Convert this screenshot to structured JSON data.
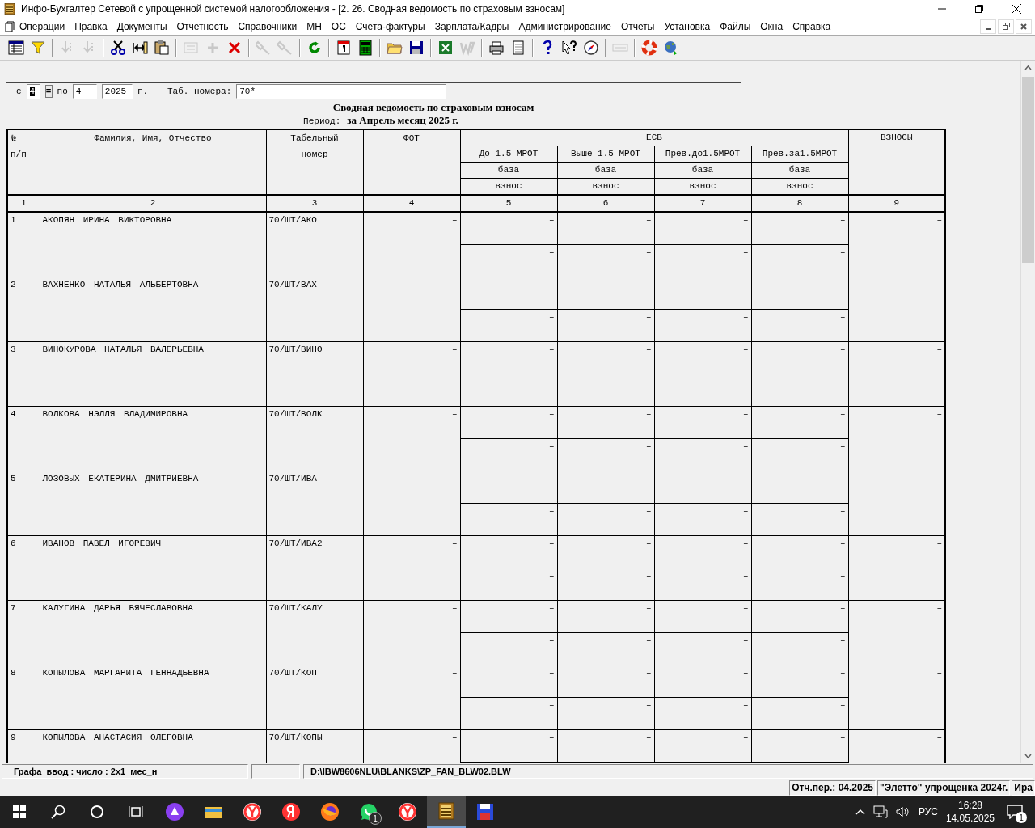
{
  "window": {
    "title": "Инфо-Бухгалтер Сетевой с упрощенной системой налогообложения - [2. 26. Сводная ведомость по страховым взносам]"
  },
  "menu": [
    "Операции",
    "Правка",
    "Документы",
    "Отчетность",
    "Справочники",
    "МН",
    "ОС",
    "Счета-фактуры",
    "Зарплата/Кадры",
    "Администрирование",
    "Отчеты",
    "Установка",
    "Файлы",
    "Окна",
    "Справка"
  ],
  "toolbar": [
    {
      "kind": "grid",
      "disabled": false
    },
    {
      "kind": "filter",
      "disabled": false
    },
    {
      "kind": "separator"
    },
    {
      "kind": "down",
      "disabled": true
    },
    {
      "kind": "down",
      "disabled": true
    },
    {
      "kind": "separator"
    },
    {
      "kind": "scissors",
      "disabled": false
    },
    {
      "kind": "insert",
      "disabled": false
    },
    {
      "kind": "paste",
      "disabled": false
    },
    {
      "kind": "separator"
    },
    {
      "kind": "counter",
      "disabled": true
    },
    {
      "kind": "plus",
      "disabled": true
    },
    {
      "kind": "delete",
      "disabled": false
    },
    {
      "kind": "separator"
    },
    {
      "kind": "torch",
      "disabled": true
    },
    {
      "kind": "torch",
      "disabled": true
    },
    {
      "kind": "separator"
    },
    {
      "kind": "refresh",
      "disabled": false
    },
    {
      "kind": "separator"
    },
    {
      "kind": "calendar",
      "disabled": false
    },
    {
      "kind": "calculator",
      "disabled": false
    },
    {
      "kind": "separator"
    },
    {
      "kind": "folder",
      "disabled": false
    },
    {
      "kind": "save",
      "disabled": false
    },
    {
      "kind": "separator"
    },
    {
      "kind": "sheet",
      "disabled": false
    },
    {
      "kind": "letter",
      "disabled": true
    },
    {
      "kind": "separator"
    },
    {
      "kind": "printer",
      "disabled": false
    },
    {
      "kind": "page",
      "disabled": false
    },
    {
      "kind": "separator"
    },
    {
      "kind": "help",
      "disabled": false
    },
    {
      "kind": "pointer",
      "disabled": false
    },
    {
      "kind": "compass",
      "disabled": false
    },
    {
      "kind": "separator"
    },
    {
      "kind": "logo",
      "disabled": true
    },
    {
      "kind": "separator"
    },
    {
      "kind": "lifebuoy",
      "disabled": false
    },
    {
      "kind": "globe",
      "disabled": false
    }
  ],
  "filter": {
    "from_label": "с",
    "month_from": {
      "value": "4",
      "focused": true
    },
    "equals_button": "=",
    "to_label": "по",
    "month_to": {
      "value": "4",
      "focused": false
    },
    "year": {
      "value": "2025",
      "focused": false
    },
    "year_suffix": "г.",
    "tab_label": "Таб. номера:",
    "tab_numbers": {
      "value": "70*",
      "focused": false
    }
  },
  "report": {
    "title": "Сводная ведомость по страховым взносам",
    "period_label": "Период:",
    "period": "за Апрель месяц 2025 г."
  },
  "table": {
    "columns": [
      "№\nп/п",
      "Фамилия, Имя, Отчество",
      "Табельный\nномер",
      "ФОТ"
    ],
    "esv": {
      "group": "ЕСВ",
      "columns": [
        {
          "label": "До 1.5 МРОТ",
          "base": "база",
          "contribution": "взнос"
        },
        {
          "label": "Выше 1.5 МРОТ",
          "base": "база",
          "contribution": "взнос"
        },
        {
          "label": "Прев.до1.5МРОТ",
          "base": "база",
          "contribution": "взнос"
        },
        {
          "label": "Прев.за1.5МРОТ",
          "base": "база",
          "contribution": "взнос"
        }
      ]
    },
    "last_column": "ВЗНОСЫ",
    "column_numbers": [
      "1",
      "2",
      "3",
      "4",
      "5",
      "6",
      "7",
      "8",
      "9"
    ],
    "rows": [
      {
        "number": "1",
        "name": "АКОПЯН ИРИНА ВИКТОРОВНА",
        "tab": "70/ШТ/АКО",
        "fot": "–",
        "esv": [
          {
            "base": "–",
            "contribution": "–"
          },
          {
            "base": "–",
            "contribution": "–"
          },
          {
            "base": "–",
            "contribution": "–"
          },
          {
            "base": "–",
            "contribution": "–"
          }
        ],
        "total": "–"
      },
      {
        "number": "2",
        "name": "ВАХНЕНКО НАТАЛЬЯ АЛЬБЕРТОВНА",
        "tab": "70/ШТ/ВАХ",
        "fot": "–",
        "esv": [
          {
            "base": "–",
            "contribution": "–"
          },
          {
            "base": "–",
            "contribution": "–"
          },
          {
            "base": "–",
            "contribution": "–"
          },
          {
            "base": "–",
            "contribution": "–"
          }
        ],
        "total": "–"
      },
      {
        "number": "3",
        "name": "ВИНОКУРОВА НАТАЛЬЯ ВАЛЕРЬЕВНА",
        "tab": "70/ШТ/ВИНО",
        "fot": "–",
        "esv": [
          {
            "base": "–",
            "contribution": "–"
          },
          {
            "base": "–",
            "contribution": "–"
          },
          {
            "base": "–",
            "contribution": "–"
          },
          {
            "base": "–",
            "contribution": "–"
          }
        ],
        "total": "–"
      },
      {
        "number": "4",
        "name": "ВОЛКОВА НЭЛЛЯ ВЛАДИМИРОВНА",
        "tab": "70/ШТ/ВОЛК",
        "fot": "–",
        "esv": [
          {
            "base": "–",
            "contribution": "–"
          },
          {
            "base": "–",
            "contribution": "–"
          },
          {
            "base": "–",
            "contribution": "–"
          },
          {
            "base": "–",
            "contribution": "–"
          }
        ],
        "total": "–"
      },
      {
        "number": "5",
        "name": "ЛОЗОВЫХ ЕКАТЕРИНА ДМИТРИЕВНА",
        "tab": "70/ШТ/ИВА",
        "fot": "–",
        "esv": [
          {
            "base": "–",
            "contribution": "–"
          },
          {
            "base": "–",
            "contribution": "–"
          },
          {
            "base": "–",
            "contribution": "–"
          },
          {
            "base": "–",
            "contribution": "–"
          }
        ],
        "total": "–"
      },
      {
        "number": "6",
        "name": "ИВАНОВ ПАВЕЛ ИГОРЕВИЧ",
        "tab": "70/ШТ/ИВА2",
        "fot": "–",
        "esv": [
          {
            "base": "–",
            "contribution": "–"
          },
          {
            "base": "–",
            "contribution": "–"
          },
          {
            "base": "–",
            "contribution": "–"
          },
          {
            "base": "–",
            "contribution": "–"
          }
        ],
        "total": "–"
      },
      {
        "number": "7",
        "name": "КАЛУГИНА ДАРЬЯ ВЯЧЕСЛАВОВНА",
        "tab": "70/ШТ/КАЛУ",
        "fot": "–",
        "esv": [
          {
            "base": "–",
            "contribution": "–"
          },
          {
            "base": "–",
            "contribution": "–"
          },
          {
            "base": "–",
            "contribution": "–"
          },
          {
            "base": "–",
            "contribution": "–"
          }
        ],
        "total": "–"
      },
      {
        "number": "8",
        "name": "КОПЫЛОВА МАРГАРИТА ГЕННАДЬЕВНА",
        "tab": "70/ШТ/КОП",
        "fot": "–",
        "esv": [
          {
            "base": "–",
            "contribution": "–"
          },
          {
            "base": "–",
            "contribution": "–"
          },
          {
            "base": "–",
            "contribution": "–"
          },
          {
            "base": "–",
            "contribution": "–"
          }
        ],
        "total": "–"
      },
      {
        "number": "9",
        "name": "КОПЫЛОВА АНАСТАСИЯ ОЛЕГОВНА",
        "tab": "70/ШТ/КОПЫ",
        "fot": "–",
        "esv": [
          {
            "base": "–"
          },
          {
            "base": "–"
          },
          {
            "base": "–"
          },
          {
            "base": "–"
          }
        ],
        "total": "–"
      }
    ]
  },
  "status_bar": {
    "hint": "Графа  ввод : число : 2x1  мес_н",
    "file": "D:\\IBW8606NLU\\BLANKS\\ZP_FAN_BLW02.BLW"
  },
  "info_bar": [
    "Отч.пер.: 04.2025",
    "\"Элетто\" упрощенка 2024г.",
    "Ира"
  ],
  "taskbar": {
    "apps": [
      {
        "kind": "assistant",
        "active": false
      },
      {
        "kind": "explorer",
        "active": false
      },
      {
        "kind": "browser",
        "active": false
      },
      {
        "kind": "yandex",
        "active": false
      },
      {
        "kind": "firefox",
        "active": false
      },
      {
        "kind": "messenger",
        "active": false,
        "badge": "1"
      },
      {
        "kind": "browser",
        "active": false
      },
      {
        "kind": "accounting",
        "active": true
      },
      {
        "kind": "floppy",
        "active": false
      }
    ],
    "language": "РУС",
    "time": "16:28",
    "date": "14.05.2025",
    "notifications": "1"
  }
}
